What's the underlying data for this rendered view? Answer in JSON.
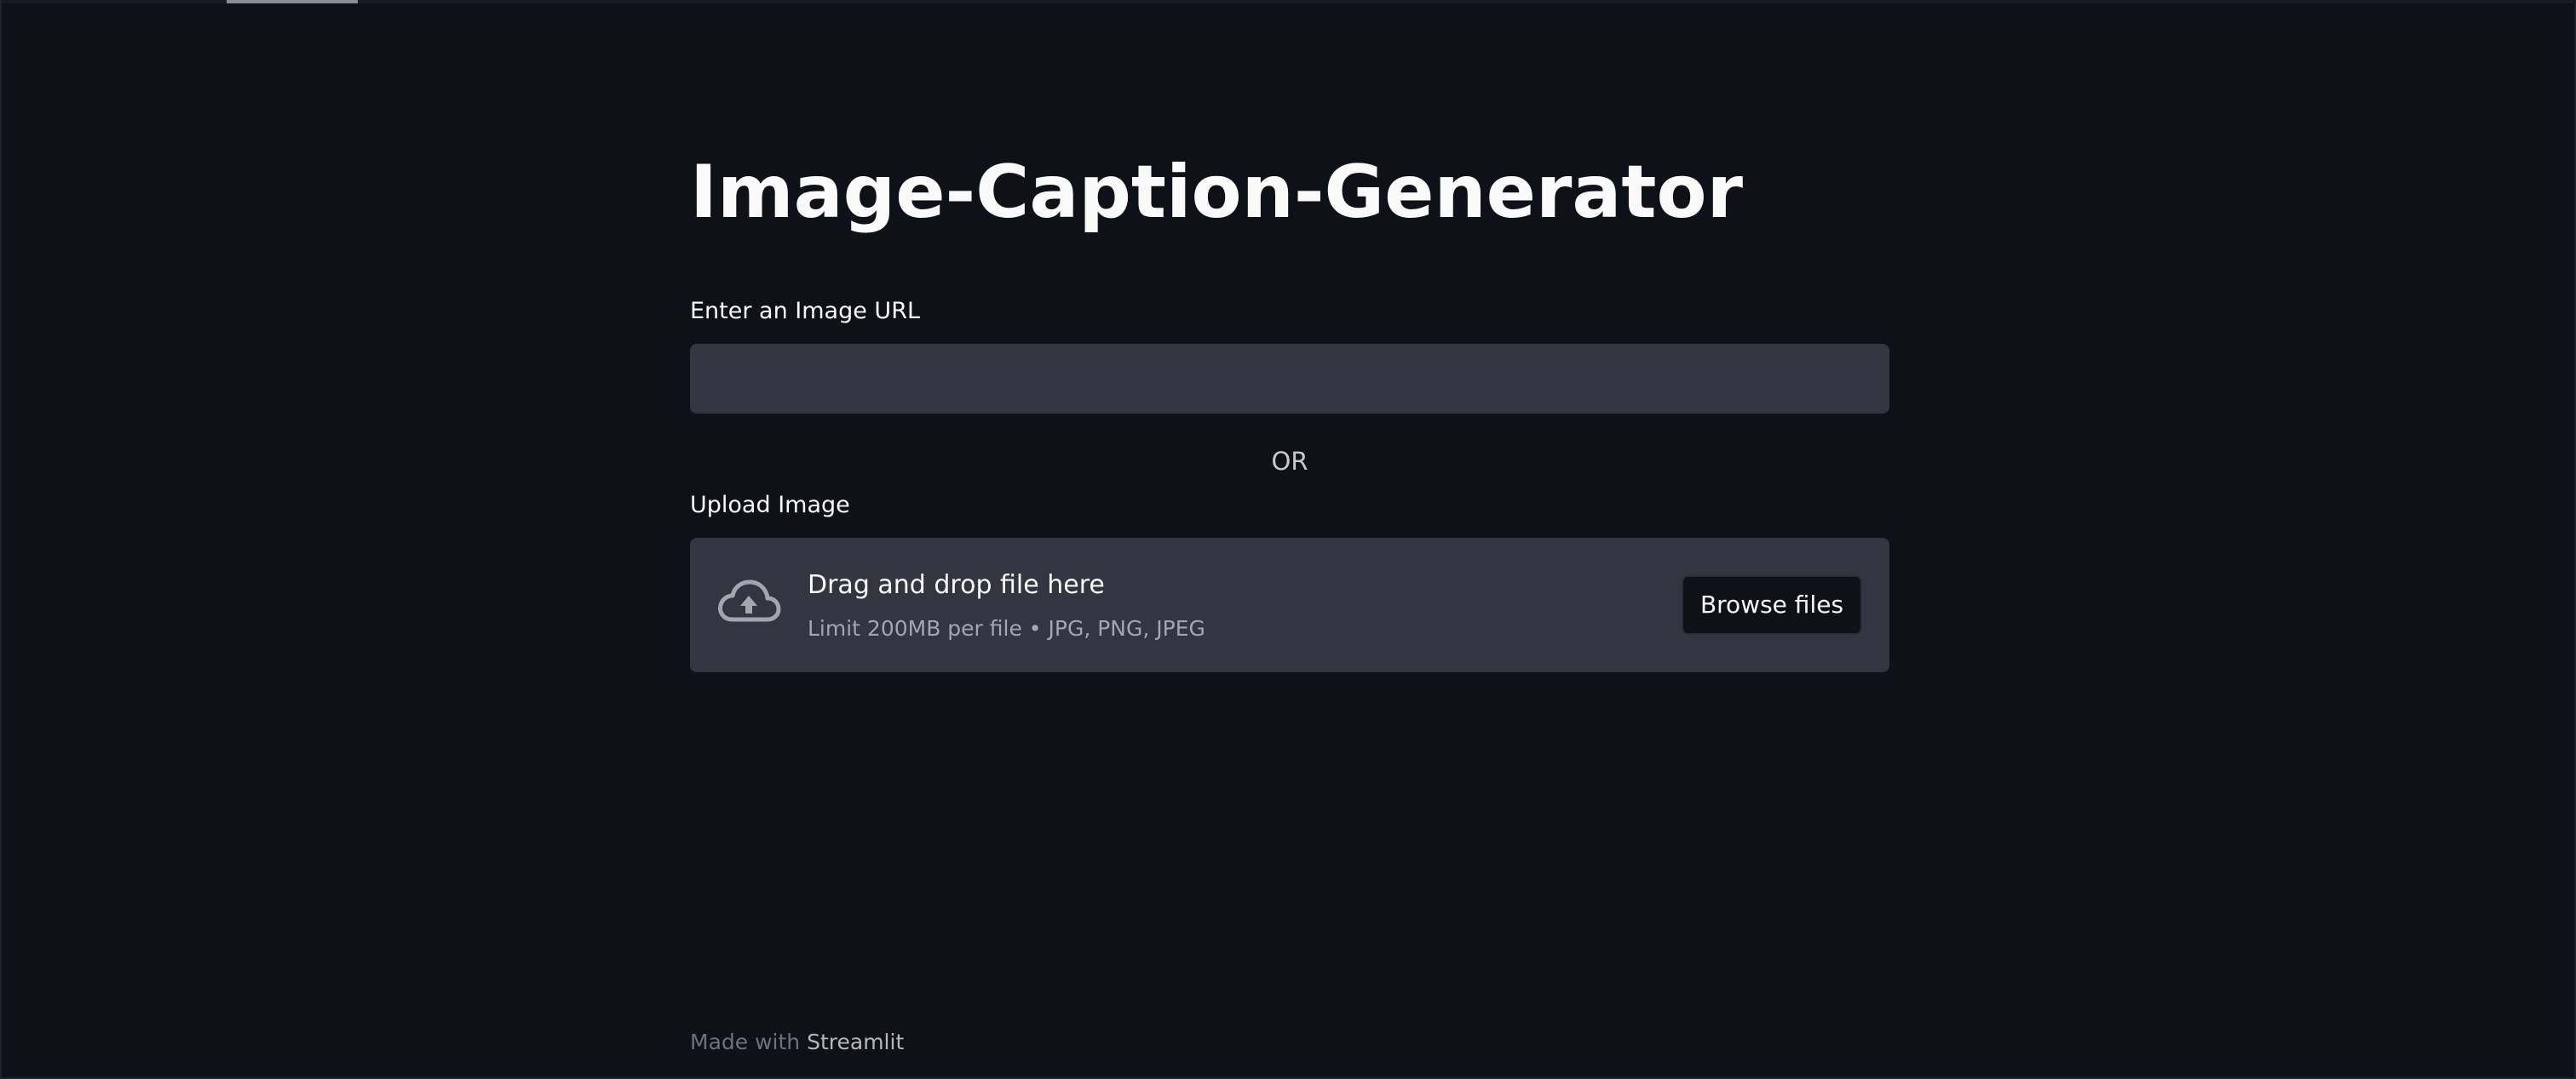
{
  "app": {
    "title": "Image-Caption-Generator"
  },
  "url_input": {
    "label": "Enter an Image URL",
    "value": "",
    "placeholder": ""
  },
  "separator": {
    "text": "OR"
  },
  "uploader": {
    "label": "Upload Image",
    "icon": "cloud-upload-icon",
    "drop_title": "Drag and drop file here",
    "drop_subtitle": "Limit 200MB per file • JPG, PNG, JPEG",
    "browse_label": "Browse files"
  },
  "footer": {
    "prefix": "Made with",
    "brand": "Streamlit"
  },
  "colors": {
    "background": "#0e1117",
    "widget_background": "#333541",
    "text": "#fafafa",
    "muted_text": "#a3a6ae"
  }
}
